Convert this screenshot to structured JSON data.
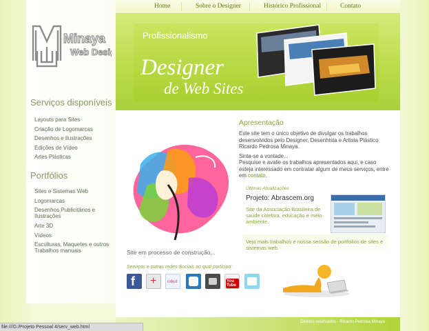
{
  "nav": {
    "items": [
      "Home",
      "Sobre o Designer",
      "Histórico Profissional",
      "Contato"
    ]
  },
  "logo": {
    "text1": "Minaya",
    "text2": "Web Design"
  },
  "banner": {
    "tag": "Profissionalismo",
    "headline1": "Designer",
    "headline2": "de Web Sites"
  },
  "sidebar": {
    "servicos_title": "Serviços disponíveis",
    "servicos": [
      "Layouts para Sites",
      "Criação de Logomarcas",
      "Desenhos e Ilustrações",
      "Edições de Vídeo",
      "Artes Plásticas"
    ],
    "portfolios_title": "Portfólios",
    "portfolios": [
      "Sites e Sistemas Web",
      "Logomarcas",
      "Desenhos Publicitários e Ilustrações",
      "Arte 3D",
      "Vídeos",
      "Esculturas, Maquetes e outros Trabalhos manuais"
    ]
  },
  "main": {
    "title": "Apresentação",
    "p1": "Este site tem o único objetivo de divulgar os trabalhos desenvolvidos pelo Designer, Desenhista e Artista Plástico Ricardo Pedrosa Minaya.",
    "p2a": "Sinta-se a vontade...",
    "p2b": "Pesquise e avalie os trabalhos apresentados aqui, e caso esteja interessado em contratar algum de meus serviços, entre em",
    "p2_link": "contato",
    "p2_end": ".",
    "ultimas": "Últimas Atualizações",
    "project_title": "Projeto: Abrascem.org",
    "project_desc": "Site da Associação Brasileira de saúde coletiva, educação e meio ambiente.",
    "veja": "Veja mais trabalhos e nossa sessão de portfólios de sites e sistemas web.",
    "construcao": "Site em processo de construção...",
    "redes": "Serviços e outras redes Sociais ao qual participo:"
  },
  "social": [
    "facebook-icon",
    "google-plus-icon",
    "orkut-icon",
    "myspace-icon",
    "stumbleupon-icon",
    "youtube-icon",
    "twitpic-icon"
  ],
  "social_labels": {
    "orkut": "orkut",
    "youtube": "You Tube"
  },
  "footer": "Direitos reservados - Ricardo Pedrosa Minaya",
  "status_url": "file:///G:/Projeto Pessoal 4/serv_web.html",
  "colors": {
    "accent": "#8aa53a",
    "banner": "#b9db46",
    "background": "#eef5c6"
  }
}
